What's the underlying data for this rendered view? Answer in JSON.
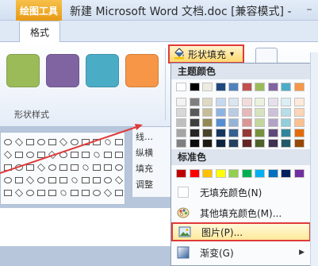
{
  "titlebar": {
    "tools_badge": "绘图工具",
    "document_title": "新建 Microsoft Word 文档.doc [兼容模式] -",
    "minimize_glyph": "–"
  },
  "ribbon": {
    "active_tab": "格式",
    "group_label": "形状样式",
    "style_swatches": [
      {
        "name": "green",
        "color": "#9bbb59"
      },
      {
        "name": "purple",
        "color": "#8064a2"
      },
      {
        "name": "teal",
        "color": "#4bacc6"
      },
      {
        "name": "orange",
        "color": "#f79646"
      }
    ],
    "fill_button_label": "形状填充",
    "fill_button_arrow": "▾"
  },
  "side_panel": {
    "items": [
      "线…",
      "纵横",
      "填充",
      "调整"
    ]
  },
  "menu": {
    "theme_colors_header": "主题颜色",
    "standard_colors_header": "标准色",
    "theme_colors": [
      [
        "#ffffff",
        "#000000",
        "#eeece1",
        "#1f497d",
        "#4f81bd",
        "#c0504d",
        "#9bbb59",
        "#8064a2",
        "#4bacc6",
        "#f79646"
      ],
      [
        "#f2f2f2",
        "#7f7f7f",
        "#ddd9c3",
        "#c6d9f0",
        "#dbe5f1",
        "#f2dcdb",
        "#ebf1dd",
        "#e5e0ec",
        "#dbeef3",
        "#fdeada"
      ],
      [
        "#d8d8d8",
        "#595959",
        "#c4bd97",
        "#8db3e2",
        "#b8cce4",
        "#e5b9b7",
        "#d7e3bc",
        "#ccc1d9",
        "#b7dde8",
        "#fbd5b5"
      ],
      [
        "#bfbfbf",
        "#3f3f3f",
        "#938953",
        "#548dd4",
        "#95b3d7",
        "#d99694",
        "#c3d69b",
        "#b2a2c7",
        "#92cddc",
        "#fac08f"
      ],
      [
        "#a5a5a5",
        "#262626",
        "#494429",
        "#17365d",
        "#366092",
        "#953734",
        "#76923c",
        "#5f497a",
        "#31859b",
        "#e36c09"
      ],
      [
        "#7f7f7f",
        "#0c0c0c",
        "#1d1b10",
        "#0f243e",
        "#244061",
        "#632423",
        "#4f6128",
        "#3f3151",
        "#205867",
        "#974806"
      ]
    ],
    "standard_colors": [
      "#c00000",
      "#ff0000",
      "#ffc000",
      "#ffff00",
      "#92d050",
      "#00b050",
      "#00b0f0",
      "#0070c0",
      "#002060",
      "#7030a0"
    ],
    "items": {
      "no_fill": "无填充颜色(N)",
      "more_colors": "其他填充颜色(M)...",
      "picture": "图片(P)...",
      "gradient": "渐变(G)"
    }
  }
}
